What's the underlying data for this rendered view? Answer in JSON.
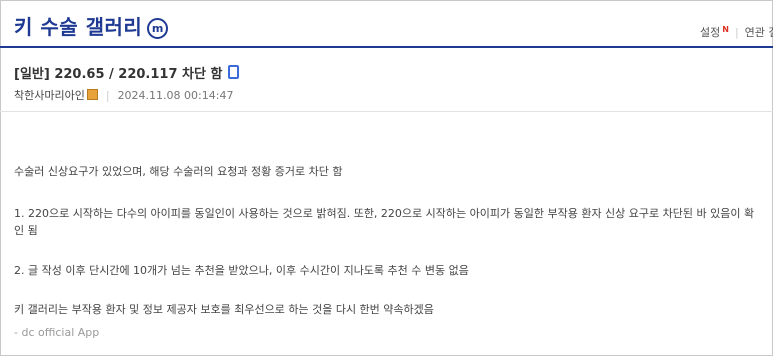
{
  "header": {
    "gallery_title": "키 수술 갤러리",
    "gallery_badge": "m",
    "settings_label": "설정",
    "settings_badge": "N",
    "related_label": "연관 갤"
  },
  "post": {
    "title": "[일반] 220.65 / 220.117 차단 함",
    "author": "착한사마리아인",
    "date": "2024.11.08 00:14:47",
    "paragraphs": [
      "수술러 신상요구가 있었으며, 해당 수술러의 요청과 정황 증거로 차단 함",
      "1. 220으로 시작하는 다수의 아이피를 동일인이 사용하는 것으로 밝혀짐. 또한, 220으로 시작하는 아이피가 동일한 부작용 환자 신상 요구로 차단된 바 있음이 확인 됨",
      "2. 글 작성 이후 단시간에 10개가 넘는 추천을 받았으나, 이후 수시간이 지나도록 추천 수 변동 없음",
      "키 갤러리는 부작용 환자 및 정보 제공자 보호를 최우선으로 하는 것을 다시 한번 약속하겠음"
    ],
    "footer": "- dc official App"
  }
}
